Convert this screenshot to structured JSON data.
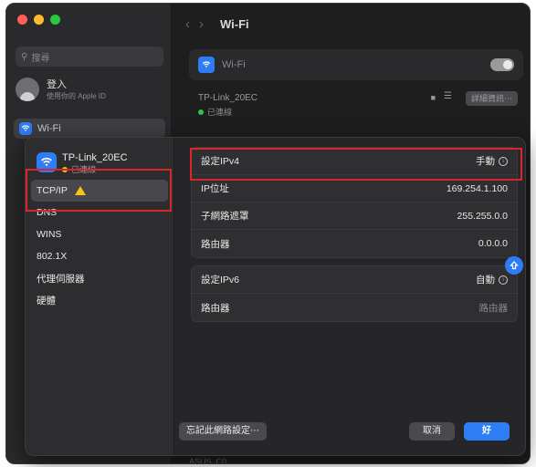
{
  "colors": {
    "accent": "#2f7df6",
    "highlight": "#d9262b",
    "close": "#ff5f57",
    "minimize": "#febc2e",
    "zoom": "#28c840"
  },
  "window": {
    "search_placeholder": "搜尋",
    "account": {
      "name": "登入",
      "subtitle": "使用你的 Apple ID"
    },
    "sidebar_wifi_label": "Wi-Fi",
    "toolbar_title": "Wi-Fi",
    "wifi_row_label": "Wi-Fi",
    "network": {
      "name": "TP-Link_20EC",
      "status": "已連線",
      "details_button": "詳細資訊⋯"
    },
    "bottom_hint": "ASUS_C0"
  },
  "sheet": {
    "network_name": "TP-Link_20EC",
    "network_status": "已連線",
    "tabs": [
      {
        "label": "TCP/IP"
      },
      {
        "label": "DNS"
      },
      {
        "label": "WINS"
      },
      {
        "label": "802.1X"
      },
      {
        "label": "代理伺服器"
      },
      {
        "label": "硬體"
      }
    ],
    "ipv4": {
      "configure_label": "設定IPv4",
      "configure_value": "手動",
      "ip_label": "IP位址",
      "ip_value": "169.254.1.100",
      "subnet_label": "子網路遮罩",
      "subnet_value": "255.255.0.0",
      "router_label": "路由器",
      "router_value": "0.0.0.0"
    },
    "ipv6": {
      "configure_label": "設定IPv6",
      "configure_value": "自動",
      "router_label": "路由器",
      "router_value": "路由器"
    },
    "buttons": {
      "forget": "忘記此網路設定⋯",
      "cancel": "取消",
      "ok": "好"
    }
  }
}
